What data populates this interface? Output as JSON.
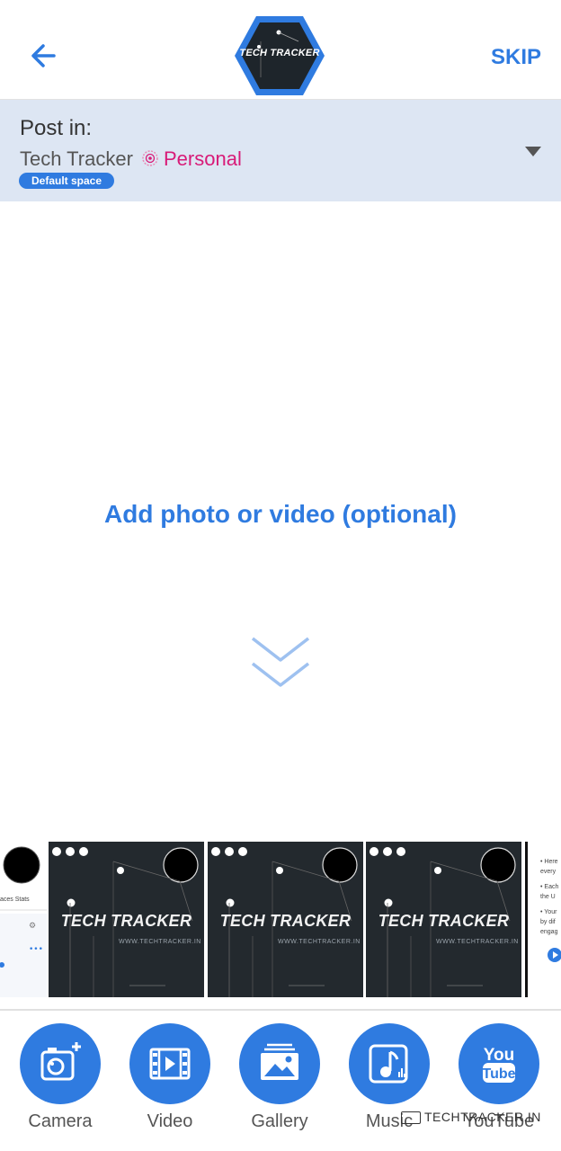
{
  "header": {
    "back_label": "back",
    "skip_label": "SKIP",
    "logo_text": "TECH TRACKER"
  },
  "post_in": {
    "label": "Post in:",
    "space_name": "Tech Tracker",
    "space_type": "Personal",
    "badge": "Default space"
  },
  "main": {
    "add_media_label": "Add photo or video (optional)"
  },
  "thumbnails": {
    "title": "TECH TRACKER",
    "subtitle": "WWW.TECHTRACKER.IN",
    "first_partial_text": "aces Stats",
    "last_partial_lines": [
      "• Here",
      "every",
      "• Each",
      "the U",
      "• Your",
      "by dif",
      "engag"
    ]
  },
  "toolbar": {
    "camera": "Camera",
    "video": "Video",
    "gallery": "Gallery",
    "music": "Music",
    "youtube": "YouTube",
    "youtube_logo_top": "You",
    "youtube_logo_bottom": "Tube"
  },
  "watermark": "TECHTRACKER.IN",
  "colors": {
    "accent": "#2f7be0",
    "personal": "#d81b78",
    "post_in_bg": "#dde6f3"
  }
}
